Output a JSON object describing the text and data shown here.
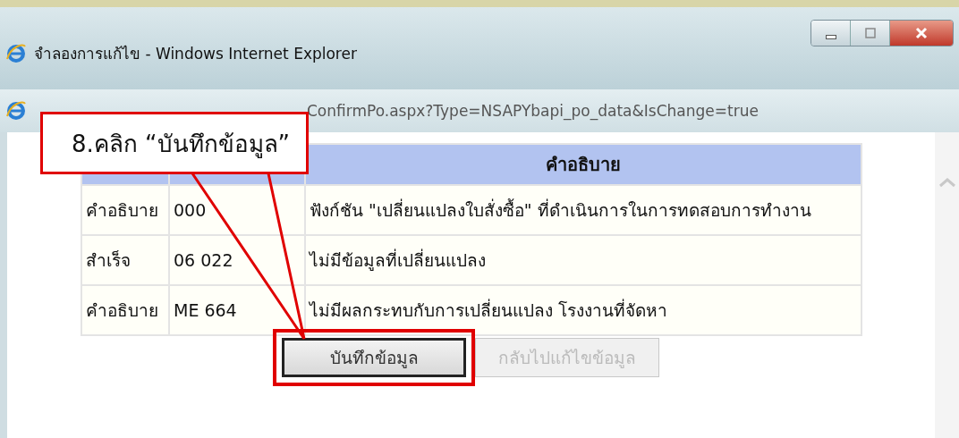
{
  "window": {
    "title": "จำลองการแก้ไข - Windows Internet Explorer",
    "address": "ConfirmPo.aspx?Type=NSAPYbapi_po_data&IsChange=true"
  },
  "table": {
    "header": "คำอธิบาย",
    "rows": [
      {
        "status": "คำอธิบาย",
        "code": "000",
        "message": "ฟังก์ชัน \"เปลี่ยนแปลงใบสั่งซื้อ\" ที่ดำเนินการในการทดสอบการทำงาน"
      },
      {
        "status": "สำเร็จ",
        "code": "06 022",
        "message": "ไม่มีข้อมูลที่เปลี่ยนแปลง"
      },
      {
        "status": "คำอธิบาย",
        "code": "ME 664",
        "message": "ไม่มีผลกระทบกับการเปลี่ยนแปลง โรงงานที่จัดหา"
      }
    ]
  },
  "buttons": [
    {
      "label": "บันทึกข้อมูล",
      "disabled": false,
      "highlighted": true
    },
    {
      "label": "กลับไปแก้ไขข้อมูล",
      "disabled": true,
      "highlighted": false
    }
  ],
  "callout": {
    "text": "8.คลิก “บันทึกข้อมูล”"
  }
}
